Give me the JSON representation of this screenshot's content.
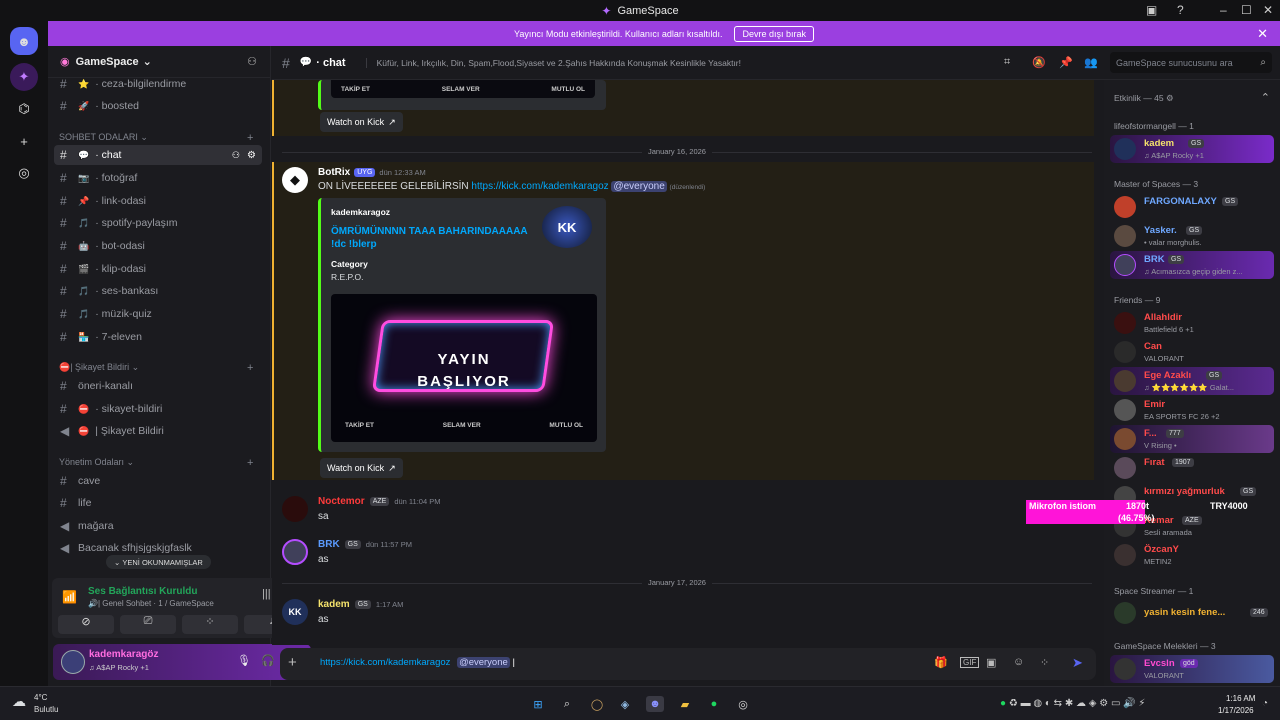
{
  "window": {
    "title": "GameSpace"
  },
  "banner": {
    "text": "Yayıncı Modu etkinleştirildi. Kullanıcı adları kısaltıldı.",
    "button": "Devre dışı bırak"
  },
  "server": {
    "name": "GameSpace"
  },
  "channels": {
    "top": [
      {
        "emoji": "⭐",
        "label": "· ceza-bilgilendirme"
      },
      {
        "emoji": "🚀",
        "label": "· boosted"
      }
    ],
    "cat1": "SOHBET ODALARI",
    "list1": [
      {
        "emoji": "💬",
        "label": "· chat"
      },
      {
        "emoji": "📷",
        "label": "· fotoğraf"
      },
      {
        "emoji": "📌",
        "label": "· link-odasi"
      },
      {
        "emoji": "🎵",
        "label": "· spotify-paylaşım"
      },
      {
        "emoji": "🤖",
        "label": "· bot-odasi"
      },
      {
        "emoji": "🎬",
        "label": "· klip-odasi"
      },
      {
        "emoji": "🎵",
        "label": "· ses-bankası"
      },
      {
        "emoji": "🎵",
        "label": "· müzik-quiz"
      },
      {
        "emoji": "🏪",
        "label": "· 7-eleven"
      }
    ],
    "cat2": "⛔| Şikayet Bildiri",
    "list2": [
      {
        "emoji": "",
        "label": "öneri-kanalı"
      },
      {
        "emoji": "⛔",
        "label": "· sikayet-bildiri"
      },
      {
        "emoji": "⛔",
        "label": "| Şikayet Bildiri"
      }
    ],
    "cat3": "Yönetim Odaları",
    "list3": [
      {
        "label": "cave"
      },
      {
        "label": "life"
      },
      {
        "label": "mağara"
      },
      {
        "label": "Bacanak sfhjsjgskjgfaslk"
      }
    ],
    "unread": "YENİ OKUNMAMIŞLAR"
  },
  "voice": {
    "status": "Ses Bağlantısı Kuruldu",
    "channel": "🔊| Genel Sohbet · 1 / GameSpace"
  },
  "user": {
    "name": "kademkaragöz",
    "status": "♫ A$AP Rocky +1"
  },
  "header": {
    "channel": "· chat",
    "topic": "Küfür, Link, Irkçılık, Din, Spam,Flood,Siyaset ve 2.Şahıs Hakkında Konuşmak Kesinlikle Yasaktır!",
    "search": "GameSpace sunucusunu ara"
  },
  "embed_top": {
    "labels": [
      "TAKİP ET",
      "SELAM VER",
      "MUTLU OL"
    ],
    "button": "Watch on Kick"
  },
  "date1": "January 16, 2026",
  "botmsg": {
    "author": "BotRix",
    "badge": "UYG",
    "time": "dün 12:33 AM",
    "text": "ON LİVEEEEEEE GELEBİLİRSİN",
    "link": "https://kick.com/kademkaragoz",
    "mention": "@everyone",
    "edited": "(düzenlendi)",
    "embed": {
      "author": "kademkaragoz",
      "title": "ÖMRÜMÜNNNN TAAA BAHARINDAAAAA !dc !blerp",
      "field": "Category",
      "value": "R.E.P.O.",
      "thumb": "KK",
      "image_l1": "YAYIN",
      "image_l2": "BAŞLIYOR",
      "labels": [
        "TAKİP ET",
        "SELAM VER",
        "MUTLU OL"
      ]
    },
    "button": "Watch on Kick"
  },
  "msg2": {
    "author": "Noctemor",
    "tag": "AZE",
    "time": "dün 11:04 PM",
    "text": "sa"
  },
  "msg3": {
    "author": "BRK",
    "tag": "GS",
    "time": "dün 11:57 PM",
    "text": "as"
  },
  "date2": "January 17, 2026",
  "msg4": {
    "author": "kadem",
    "tag": "GS",
    "time": "1:17 AM",
    "text": "as"
  },
  "composer": {
    "link": "https://kick.com/kademkaragoz",
    "mention": "@everyone"
  },
  "members": {
    "activity": "Etkinlik — 45",
    "g1": "lifeofstormangell — 1",
    "g1m": [
      {
        "name": "kadem",
        "tag": "GS",
        "status": "♫ A$AP Rocky +1",
        "color": "#f5e36c"
      }
    ],
    "g2": "Master of Spaces — 3",
    "g2m": [
      {
        "name": "FARGONALAXY",
        "tag": "GS",
        "status": "",
        "color": "#6fa8ff"
      },
      {
        "name": "Yasker.",
        "tag": "GS",
        "status": "• valar morghulis.",
        "color": "#6fa8ff"
      },
      {
        "name": "BRK",
        "tag": "GS",
        "status": "♫ Acımasızca geçip giden z...",
        "color": "#6fa8ff"
      }
    ],
    "g3": "Friends — 9",
    "g3m": [
      {
        "name": "Allahldir",
        "status": "Battlefield 6 +1",
        "color": "#ff4b4b"
      },
      {
        "name": "Can",
        "status": "VALORANT",
        "color": "#ff4b4b"
      },
      {
        "name": "Ege Azaklı",
        "tag": "GS",
        "status": "♫ ⭐⭐⭐⭐⭐⭐ Galat...",
        "color": "#ff4b4b"
      },
      {
        "name": "Emir",
        "status": "EA SPORTS FC 26 +2",
        "color": "#ff4b4b"
      },
      {
        "name": "F...",
        "tag": "777",
        "status": "V Rising •",
        "color": "#ff4b4b"
      },
      {
        "name": "Fırat",
        "tag": "1907",
        "status": "",
        "color": "#ff4b4b"
      },
      {
        "name": "kırmızı yağmurluk",
        "tag": "GS",
        "status": "",
        "color": "#ff4b4b"
      },
      {
        "name": "Kemar",
        "tag": "AZE",
        "status": "Sesli aramada",
        "color": "#ff4b4b"
      },
      {
        "name": "ÖzcanY",
        "status": "METIN2",
        "color": "#ff4b4b"
      }
    ],
    "g4": "Space Streamer — 1",
    "g4m": [
      {
        "name": "yasin kesin fene...",
        "tag": "246",
        "status": "",
        "color": "#f0b232"
      }
    ],
    "g5": "GameSpace Melekleri — 3",
    "g5m": [
      {
        "name": "Evcsln",
        "tag": "göd",
        "status": "VALORANT",
        "color": "#ff4bd0"
      }
    ]
  },
  "overlay": {
    "label": "Mikrofon istiom",
    "value": "1870t",
    "target": "TRY4000",
    "percent": "(46.75%)",
    "fill": 46.75
  },
  "taskbar": {
    "temp": "4°C",
    "weather": "Bulutlu",
    "time": "1:16 AM",
    "date": "1/17/2026"
  }
}
